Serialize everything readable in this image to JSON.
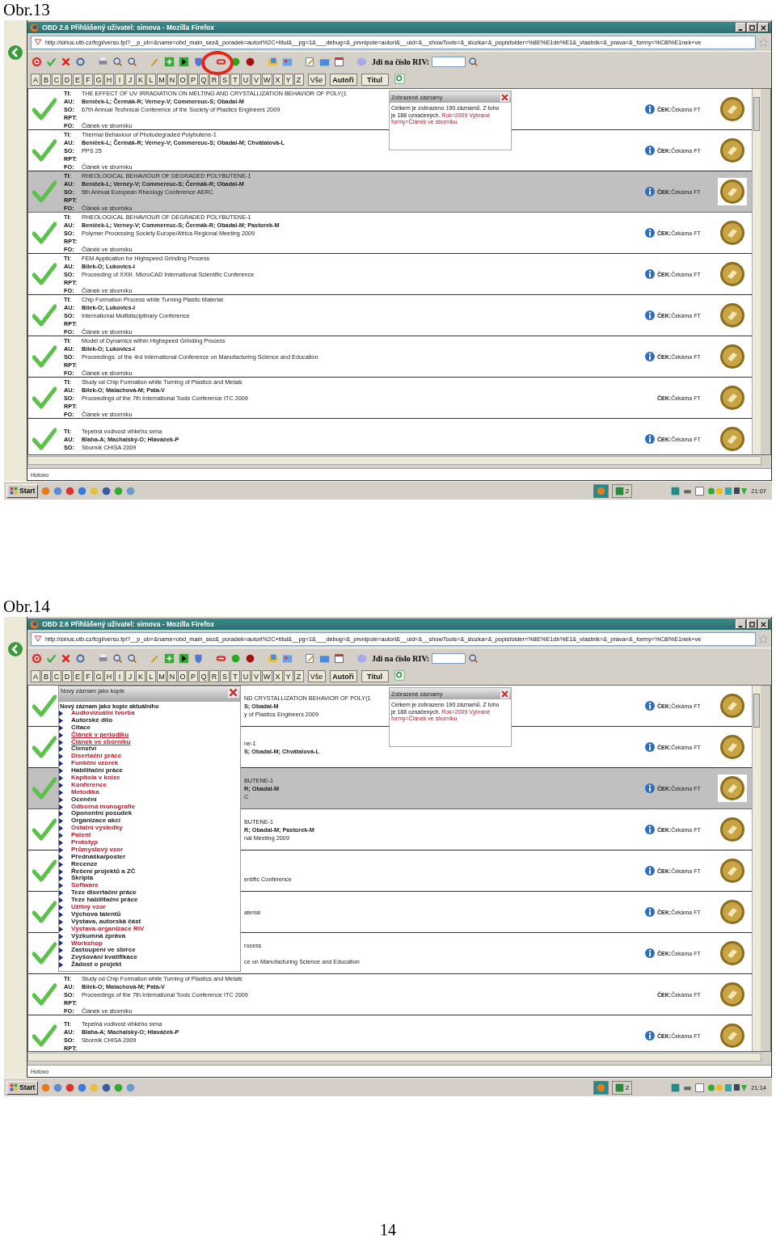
{
  "figures": [
    {
      "caption": "Obr.13",
      "screen": {
        "title": "OBD 2.6 Přihlášený uživatel: simova - Mozilla Firefox",
        "url": "http://sirius.utb.cz/fcgi/verso.fpl?__p_ob=&name=obd_main_sez&_poradek=autori%2C+titul&__pg=1&___debug=&_prvnipole=autori&__uid=&__showTools=&_slozka=&_popisfolder=%8E%E1dn%E1&_vlastnik=&_prava=&_formy=%C8l%E1nek+ve",
        "circled": true,
        "riv_label": "Jdi na číslo RIV:",
        "letters": [
          "A",
          "B",
          "C",
          "D",
          "E",
          "F",
          "G",
          "H",
          "I",
          "J",
          "K",
          "L",
          "M",
          "N",
          "O",
          "P",
          "Q",
          "R",
          "S",
          "T",
          "U",
          "V",
          "W",
          "X",
          "Y",
          "Z"
        ],
        "word_buttons": [
          "Vše",
          "Autoři",
          "Titul"
        ],
        "panel": {
          "title": "Zobrazené záznamy",
          "text": "Celkem je zobrazeno 190 záznamů. Z toho je 188 označených.",
          "filter": "Rok=2009 Vybrané formy=Článek ve sborníku"
        },
        "records": [
          {
            "kind": "full",
            "selected": false,
            "info": true,
            "status": "**ČEK:**Čekáma FT",
            "lines": [
              {
                "kind": "ti",
                "label": "TI:",
                "text": "THE EFFECT OF UV IRRADIATION ON MELTING AND CRYSTALLIZATION BEHAVIOR OF POLY(1"
              },
              {
                "kind": "au",
                "label": "AU:",
                "text": "Beníček-L; Čermák-R; Verney-V; Commereuc-S; Obadal-M"
              },
              {
                "kind": "so",
                "label": "SO:",
                "text": "67th Annual Technical Conference of the Society of Plastics Engineers 2009"
              },
              {
                "kind": "rpt",
                "label": "RPT:"
              },
              {
                "kind": "fo",
                "label": "FO:",
                "text": "Článek ve sborníku"
              }
            ]
          },
          {
            "kind": "full",
            "selected": false,
            "info": true,
            "status": "**ČEK:**Čekáma FT",
            "lines": [
              {
                "kind": "ti",
                "label": "TI:",
                "text": "Thermal Behaviour of Photodegraded Polybutene-1"
              },
              {
                "kind": "au",
                "label": "AU:",
                "text": "Beníček-L; Čermák-R; Verney-V; Commereuc-S; Obadal-M; Chvátalová-L"
              },
              {
                "kind": "so",
                "label": "SO:",
                "text": "PPS 25"
              },
              {
                "kind": "rpt",
                "label": "RPT:"
              },
              {
                "kind": "fo",
                "label": "FO:",
                "text": "Článek ve sborníku"
              }
            ]
          },
          {
            "kind": "full",
            "selected": true,
            "info": true,
            "status": "**ČEK:**Čekáma FT",
            "lines": [
              {
                "kind": "ti",
                "label": "TI:",
                "text": "RHEOLOGICAL BEHAVIOUR OF DEGRADED POLYBUTENE-1"
              },
              {
                "kind": "au",
                "label": "AU:",
                "text": "Beníček-L; Verney-V; Commereuc-S; Čermák-R; Obadal-M"
              },
              {
                "kind": "so",
                "label": "SO:",
                "text": "5th Annual European Rheology Conference AERC"
              },
              {
                "kind": "rpt",
                "label": "RPT:"
              },
              {
                "kind": "fo",
                "label": "FO:",
                "text": "Článek ve sborníku"
              }
            ]
          },
          {
            "kind": "full",
            "selected": false,
            "info": true,
            "status": "**ČEK:**Čekáma FT",
            "lines": [
              {
                "kind": "ti",
                "label": "TI:",
                "text": "RHEOLOGICAL BEHAVIOUR OF DEGRADED POLYBUTENE-1"
              },
              {
                "kind": "au",
                "label": "AU:",
                "text": "Beníček-L; Verney-V; Commereuc-S; Čermák-R; Obadal-M; Pastorek-M"
              },
              {
                "kind": "so",
                "label": "SO:",
                "text": "Polymer Processing Society Europe/Africa Regional Meeting 2009"
              },
              {
                "kind": "rpt",
                "label": "RPT:"
              },
              {
                "kind": "fo",
                "label": "FO:",
                "text": "Článek ve sborníku"
              }
            ]
          },
          {
            "kind": "full",
            "selected": false,
            "info": true,
            "status": "**ČEK:**Čekáma FT",
            "lines": [
              {
                "kind": "ti",
                "label": "TI:",
                "text": "FEM Application for Highspeed Grinding Process"
              },
              {
                "kind": "au",
                "label": "AU:",
                "text": "Bílek-O; Lukovics-I"
              },
              {
                "kind": "so",
                "label": "SO:",
                "text": "Proceeding of XXIII. MicroCAD International Scientific Conference"
              },
              {
                "kind": "rpt",
                "label": "RPT:"
              },
              {
                "kind": "fo",
                "label": "FO:",
                "text": "Článek ve sborníku"
              }
            ]
          },
          {
            "kind": "full",
            "selected": false,
            "info": true,
            "status": "**ČEK:**Čekáma FT",
            "lines": [
              {
                "kind": "ti",
                "label": "TI:",
                "text": "Chip Formation Process while Turning Plastic Material"
              },
              {
                "kind": "au",
                "label": "AU:",
                "text": "Bílek-O; Lukovics-I"
              },
              {
                "kind": "so",
                "label": "SO:",
                "text": "International Multidisciplinary Conference"
              },
              {
                "kind": "rpt",
                "label": "RPT:"
              },
              {
                "kind": "fo",
                "label": "FO:",
                "text": "Článek ve sborníku"
              }
            ]
          },
          {
            "kind": "full",
            "selected": false,
            "info": true,
            "status": "**ČEK:**Čekáma FT",
            "lines": [
              {
                "kind": "ti",
                "label": "TI:",
                "text": "Model of Dynamics within Highspeed Grinding Process"
              },
              {
                "kind": "au",
                "label": "AU:",
                "text": "Bílek-O; Lukovics-I"
              },
              {
                "kind": "so",
                "label": "SO:",
                "text": "Proceedings: of the 4rd International Conference on Manufacturing Science and Education"
              },
              {
                "kind": "rpt",
                "label": "RPT:"
              },
              {
                "kind": "fo",
                "label": "FO:",
                "text": "Článek ve sborníku"
              }
            ]
          },
          {
            "kind": "full",
            "selected": false,
            "info": false,
            "status": "**ČEK:**Čekáma FT",
            "lines": [
              {
                "kind": "ti",
                "label": "TI:",
                "text": "Study od Chip Formation while Turning of Plastics and Metals"
              },
              {
                "kind": "au",
                "label": "AU:",
                "text": "Bílek-O; Malachová-M; Pata-V"
              },
              {
                "kind": "so",
                "label": "SO:",
                "text": "Proceedings of the 7th International Tools Conference ITC 2009"
              },
              {
                "kind": "rpt",
                "label": "RPT:"
              },
              {
                "kind": "fo",
                "label": "FO:",
                "text": "Článek ve sborníku"
              }
            ]
          },
          {
            "kind": "full",
            "selected": false,
            "info": true,
            "status": "**ČEK:**Čekáma FT",
            "lines": [
              {
                "kind": "ti",
                "label": "TI:",
                "text": "Tepelná vodivost vlhkého sena"
              },
              {
                "kind": "au",
                "label": "AU:",
                "text": "Blaha-A; Machalský-O; Hlaváček-P"
              },
              {
                "kind": "so",
                "label": "SO:",
                "text": "Sborník CHISA 2009"
              }
            ]
          }
        ],
        "status_bar": "Hotovo",
        "taskbar": {
          "start": "Start",
          "group_count": "2",
          "time": "21:07"
        }
      }
    },
    {
      "caption": "Obr.14",
      "screen": {
        "title": "OBD 2.6 Přihlášený uživatel: simova - Mozilla Firefox",
        "url": "http://sirius.utb.cz/fcgi/verso.fpl?__p_ob=&name=obd_main_sez&_poradek=autori%2C+titul&__pg=1&___debug=&_prvnipole=autori&__uid=&__showTools=&_slozka=&_popisfolder=%8E%E1dn%E1&_vlastnik=&_prava=&_formy=%C8l%E1nek+ve",
        "circled": false,
        "riv_label": "Jdi na číslo RIV:",
        "letters": [
          "A",
          "B",
          "C",
          "D",
          "E",
          "F",
          "G",
          "H",
          "I",
          "J",
          "K",
          "L",
          "M",
          "N",
          "O",
          "P",
          "Q",
          "R",
          "S",
          "T",
          "U",
          "V",
          "W",
          "X",
          "Y",
          "Z"
        ],
        "word_buttons": [
          "Vše",
          "Autoři",
          "Titul"
        ],
        "panel": {
          "title": "Zobrazené záznamy",
          "text": "Celkem je zobrazeno 190 záznamů. Z toho je 188 označených.",
          "filter": "Rok=2009 Vybrané formy=Článek ve sborníku"
        },
        "menu": {
          "title": "Nový záznam jako kopie",
          "heading": "Nový záznam jako kopie aktuálního",
          "items": [
            {
              "label": "Audiovizuální tvorba",
              "color": "#b5202e",
              "underlined": false
            },
            {
              "label": "Autorské dílo",
              "color": "#222222",
              "underlined": false
            },
            {
              "label": "Citace",
              "color": "#222222",
              "underlined": false
            },
            {
              "label": "Článek v periodiku",
              "color": "#b5202e",
              "underlined": true
            },
            {
              "label": "Článek ve sborníku",
              "color": "#b5202e",
              "underlined": true
            },
            {
              "label": "Členství",
              "color": "#222222",
              "underlined": false
            },
            {
              "label": "Disertační práce",
              "color": "#b5202e",
              "underlined": false
            },
            {
              "label": "Funkční vzorek",
              "color": "#b5202e",
              "underlined": false
            },
            {
              "label": "Habilitační práce",
              "color": "#222222",
              "underlined": false
            },
            {
              "label": "Kapitola v knize",
              "color": "#b5202e",
              "underlined": false
            },
            {
              "label": "Konference",
              "color": "#b5202e",
              "underlined": false
            },
            {
              "label": "Metodika",
              "color": "#b5202e",
              "underlined": false
            },
            {
              "label": "Ocenění",
              "color": "#222222",
              "underlined": false
            },
            {
              "label": "Odborná monografie",
              "color": "#b5202e",
              "underlined": false
            },
            {
              "label": "Oponentní posudek",
              "color": "#222222",
              "underlined": false
            },
            {
              "label": "Organizace akcí",
              "color": "#222222",
              "underlined": false
            },
            {
              "label": "Ostatní výsledky",
              "color": "#b5202e",
              "underlined": false
            },
            {
              "label": "Patent",
              "color": "#b5202e",
              "underlined": false
            },
            {
              "label": "Prototyp",
              "color": "#b5202e",
              "underlined": false
            },
            {
              "label": "Průmyslový vzor",
              "color": "#b5202e",
              "underlined": false
            },
            {
              "label": "Přednáška/poster",
              "color": "#222222",
              "underlined": false
            },
            {
              "label": "Recenze",
              "color": "#222222",
              "underlined": false
            },
            {
              "label": "Řešení projektů a ZČ",
              "color": "#222222",
              "underlined": false
            },
            {
              "label": "Skripta",
              "color": "#222222",
              "underlined": false
            },
            {
              "label": "Software",
              "color": "#b5202e",
              "underlined": false
            },
            {
              "label": "Teze disertační práce",
              "color": "#222222",
              "underlined": false
            },
            {
              "label": "Teze habilitační práce",
              "color": "#222222",
              "underlined": false
            },
            {
              "label": "Užitný vzor",
              "color": "#b5202e",
              "underlined": false
            },
            {
              "label": "Výchova talentů",
              "color": "#222222",
              "underlined": false
            },
            {
              "label": "Výstava, autorská část",
              "color": "#222222",
              "underlined": false
            },
            {
              "label": "Výstava-organizace RIV",
              "color": "#b5202e",
              "underlined": false
            },
            {
              "label": "Výzkumná zpráva",
              "color": "#222222",
              "underlined": false
            },
            {
              "label": "Workshop",
              "color": "#b5202e",
              "underlined": false
            },
            {
              "label": "Zastoupení ve sbírce",
              "color": "#222222",
              "underlined": false
            },
            {
              "label": "Zvyšování kvalifikace",
              "color": "#222222",
              "underlined": false
            },
            {
              "label": "Žádost o projekt",
              "color": "#222222",
              "underlined": false
            }
          ]
        },
        "records": [
          {
            "kind": "covered",
            "selected": false,
            "info": true,
            "status": "**ČEK:**Čekáma FT",
            "lines": [
              {
                "kind": "ti",
                "text": "ND CRYSTALLIZATION BEHAVIOR OF POLY(1"
              },
              {
                "kind": "au",
                "text": "S; Obadal-M"
              },
              {
                "kind": "so",
                "text": "y of Plastics Engineers 2009"
              }
            ]
          },
          {
            "kind": "covered",
            "selected": false,
            "info": true,
            "status": "**ČEK:**Čekáma FT",
            "lines": [
              {
                "kind": "ti",
                "text": "ne-1"
              },
              {
                "kind": "au",
                "text": "S; Obadal-M; Chvátalová-L"
              }
            ]
          },
          {
            "kind": "covered",
            "selected": true,
            "info": true,
            "status": "**ČEK:**Čekáma FT",
            "lines": [
              {
                "kind": "ti",
                "text": "BUTENE-1"
              },
              {
                "kind": "au",
                "text": "R; Obadal-M"
              },
              {
                "kind": "so",
                "text": "C"
              }
            ]
          },
          {
            "kind": "covered",
            "selected": false,
            "info": true,
            "status": "**ČEK:**Čekáma FT",
            "lines": [
              {
                "kind": "ti",
                "text": "BUTENE-1"
              },
              {
                "kind": "au",
                "text": "R; Obadal-M; Pastorek-M"
              },
              {
                "kind": "so",
                "text": "nal Meeting 2009"
              }
            ]
          },
          {
            "kind": "covered",
            "selected": false,
            "info": true,
            "status": "**ČEK:**Čekáma FT",
            "lines": [
              {
                "kind": "so",
                "text": "entific Conference"
              }
            ]
          },
          {
            "kind": "covered",
            "selected": false,
            "info": true,
            "status": "**ČEK:**Čekáma FT",
            "lines": [
              {
                "kind": "ti",
                "text": "aterial"
              }
            ]
          },
          {
            "kind": "covered",
            "selected": false,
            "info": true,
            "status": "**ČEK:**Čekáma FT",
            "lines": [
              {
                "kind": "ti",
                "text": "rocess"
              },
              {
                "kind": "so",
                "text": "ce on Manufacturing Science and Education"
              }
            ]
          },
          {
            "kind": "full",
            "selected": false,
            "info": false,
            "status": "**ČEK:**Čekáma FT",
            "lines": [
              {
                "kind": "ti",
                "label": "TI:",
                "text": "Study od Chip Formation while Turning of Plastics and Metals"
              },
              {
                "kind": "au",
                "label": "AU:",
                "text": "Bílek-O; Malachová-M; Pata-V"
              },
              {
                "kind": "so",
                "label": "SO:",
                "text": "Proceedings of the 7th International Tools Conference ITC 2009"
              },
              {
                "kind": "rpt",
                "label": "RPT:"
              },
              {
                "kind": "fo",
                "label": "FO:",
                "text": "Článek ve sborníku"
              }
            ]
          },
          {
            "kind": "full",
            "selected": false,
            "info": true,
            "status": "**ČEK:**Čekáma FT",
            "lines": [
              {
                "kind": "ti",
                "label": "TI:",
                "text": "Tepelná vodivost vlhkého sena"
              },
              {
                "kind": "au",
                "label": "AU:",
                "text": "Blaha-A; Machalský-O; Hlaváček-P"
              },
              {
                "kind": "so",
                "label": "SO:",
                "text": "Sborník CHISA 2009"
              },
              {
                "kind": "rpt",
                "label": "RPT:"
              }
            ]
          }
        ],
        "status_bar": "Hotovo",
        "taskbar": {
          "start": "Start",
          "group_count": "2",
          "time": "21:14"
        }
      }
    }
  ],
  "page_number": "14"
}
